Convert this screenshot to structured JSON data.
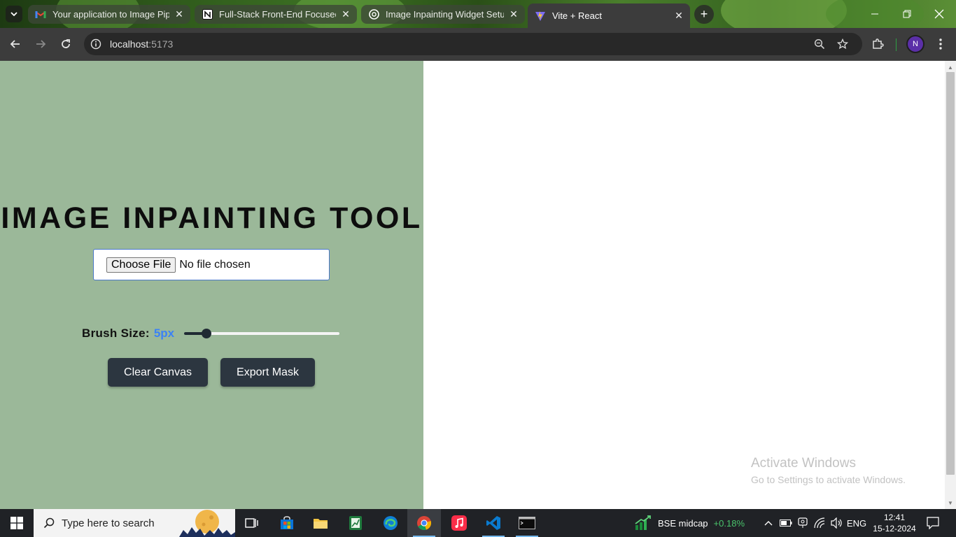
{
  "browser": {
    "tabs": [
      {
        "title": "Your application to Image Pipel",
        "favicon": "gmail-icon",
        "active": false
      },
      {
        "title": "Full-Stack Front-End Focused In",
        "favicon": "notion-icon",
        "active": false
      },
      {
        "title": "Image Inpainting Widget Setup",
        "favicon": "chatgpt-icon",
        "active": false
      },
      {
        "title": "Vite + React",
        "favicon": "vite-icon",
        "active": true
      }
    ],
    "address": {
      "host": "localhost",
      "port": ":5173"
    },
    "profile_initial": "N"
  },
  "app": {
    "title": "IMAGE INPAINTING TOOL",
    "file_input": {
      "button_label": "Choose File",
      "status": "No file chosen"
    },
    "brush": {
      "label": "Brush Size:",
      "value_text": "5px",
      "value": 5,
      "min": 1,
      "max": 50
    },
    "buttons": {
      "clear": "Clear Canvas",
      "export": "Export Mask"
    },
    "colors": {
      "panel_bg": "#9bb899",
      "accent": "#3b82f6",
      "button_bg": "#2c3640"
    }
  },
  "watermark": {
    "line1": "Activate Windows",
    "line2": "Go to Settings to activate Windows."
  },
  "taskbar": {
    "search_placeholder": "Type here to search",
    "stock": {
      "name": "BSE midcap",
      "change": "+0.18%"
    },
    "language": "ENG",
    "time": "12:41",
    "date": "15-12-2024"
  }
}
